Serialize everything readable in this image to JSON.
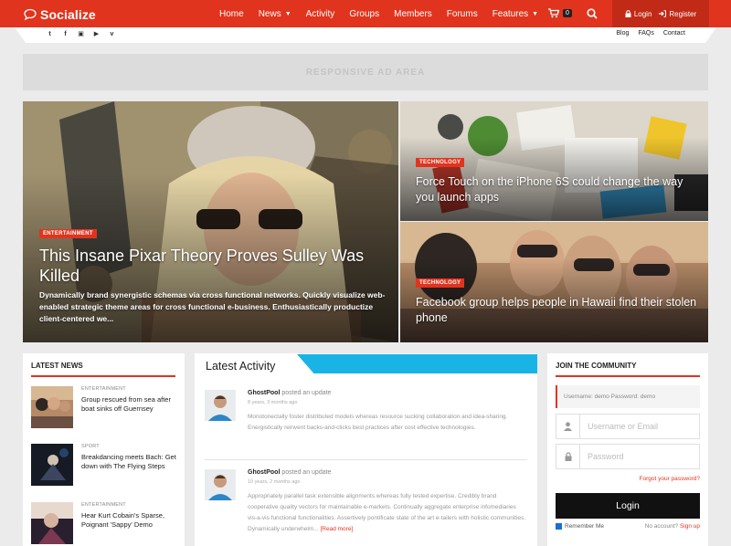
{
  "header": {
    "logo": "Socialize",
    "nav": [
      {
        "label": "Home",
        "caret": false
      },
      {
        "label": "News",
        "caret": true
      },
      {
        "label": "Activity",
        "caret": false
      },
      {
        "label": "Groups",
        "caret": false
      },
      {
        "label": "Members",
        "caret": false
      },
      {
        "label": "Forums",
        "caret": false
      },
      {
        "label": "Features",
        "caret": true
      }
    ],
    "cart_count": "0",
    "login": "Login",
    "register": "Register",
    "accent": "#e1341e"
  },
  "subbar": {
    "social_icons": [
      "twitter-icon",
      "facebook-icon",
      "instagram-icon",
      "youtube-icon",
      "vine-icon"
    ],
    "links": [
      "Blog",
      "FAQs",
      "Contact"
    ]
  },
  "ad": {
    "label": "RESPONSIVE AD AREA"
  },
  "hero": {
    "main": {
      "category": "ENTERTAINMENT",
      "title": "This Insane Pixar Theory Proves Sulley Was Killed",
      "excerpt": "Dynamically brand synergistic schemas via cross functional networks. Quickly visualize web-enabled strategic theme areas for cross functional e-business. Enthusiastically productize client-centered we..."
    },
    "top": {
      "category": "TECHNOLOGY",
      "title": "Force Touch on the iPhone 6S could change the way you launch apps"
    },
    "bottom": {
      "category": "TECHNOLOGY",
      "title": "Facebook group helps people in Hawaii find their stolen phone"
    }
  },
  "latest_news": {
    "heading": "LATEST NEWS",
    "items": [
      {
        "category": "ENTERTAINMENT",
        "title": "Group rescued from sea after boat sinks off Guernsey"
      },
      {
        "category": "SPORT",
        "title": "Breakdancing meets Bach: Get down with The Flying Steps"
      },
      {
        "category": "ENTERTAINMENT",
        "title": "Hear Kurt Cobain's Sparse, Poignant 'Sappy' Demo"
      }
    ]
  },
  "activity": {
    "heading": "Latest Activity",
    "items": [
      {
        "user": "GhostPool",
        "action": "posted an update",
        "time": "8 years, 3 months ago",
        "body": "Monotonectally foster distributed models whereas resource sucking collaboration and idea-sharing. Energistically reinvent backs-and-clicks best practices after cost effective technologies.",
        "more": ""
      },
      {
        "user": "GhostPool",
        "action": "posted an update",
        "time": "10 years, 2 months ago",
        "body": "Appropriately parallel task extensible alignments whereas fully tested expertise. Credibly brand cooperative quality vectors for maintainable e-markets. Continually aggregate enterprise infomediaries vis-a-vis functional functionalities. Assertively pontificate state of the art e-tailers with holistic communities. Dynamically underwhelm...",
        "more": "[Read more]"
      }
    ]
  },
  "community": {
    "heading": "JOIN THE COMMUNITY",
    "demo": "Username: demo   Password: demo",
    "username_placeholder": "Username or Email",
    "password_placeholder": "Password",
    "forgot": "Forgot your password?",
    "login_button": "Login",
    "remember": "Remember Me",
    "no_account": "No account?",
    "signup": "Sign up"
  }
}
